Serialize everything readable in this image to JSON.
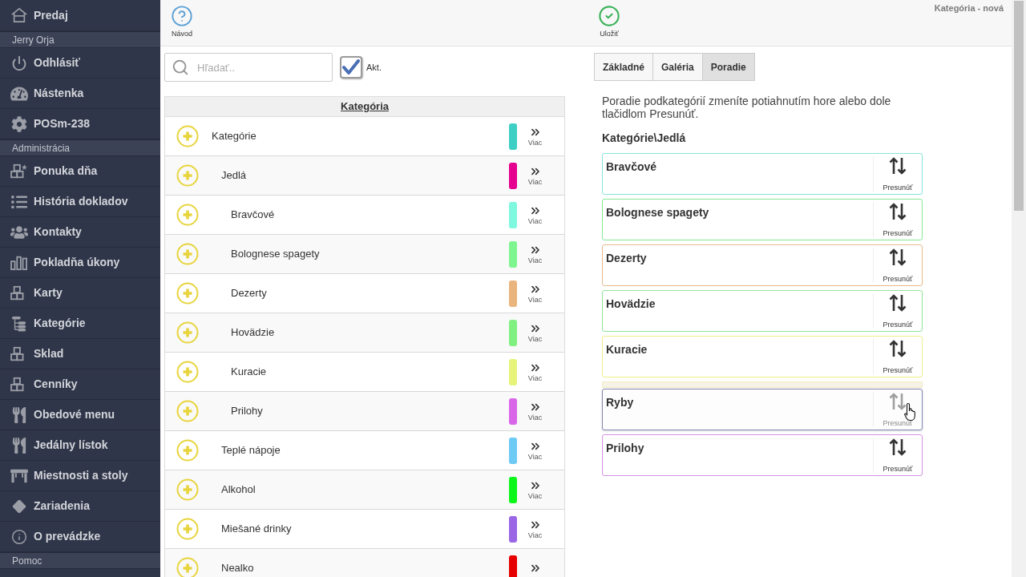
{
  "sidebar": {
    "items": [
      {
        "kind": "link",
        "label": "Predaj"
      },
      {
        "kind": "section",
        "label": "Jerry Orja"
      },
      {
        "kind": "link",
        "label": "Odhlásiť"
      },
      {
        "kind": "link",
        "label": "Nástenka"
      },
      {
        "kind": "link",
        "label": "POSm-238"
      },
      {
        "kind": "section",
        "label": "Administrácia"
      },
      {
        "kind": "link",
        "label": "Ponuka dňa"
      },
      {
        "kind": "link",
        "label": "História dokladov"
      },
      {
        "kind": "link",
        "label": "Kontakty"
      },
      {
        "kind": "link",
        "label": "Pokladňa úkony"
      },
      {
        "kind": "link",
        "label": "Karty"
      },
      {
        "kind": "link",
        "label": "Kategórie"
      },
      {
        "kind": "link",
        "label": "Sklad"
      },
      {
        "kind": "link",
        "label": "Cenníky"
      },
      {
        "kind": "link",
        "label": "Obedové menu"
      },
      {
        "kind": "link",
        "label": "Jedálny lístok"
      },
      {
        "kind": "link",
        "label": "Miestnosti a stoly"
      },
      {
        "kind": "link",
        "label": "Zariadenia"
      },
      {
        "kind": "link",
        "label": "O prevádzke"
      },
      {
        "kind": "section",
        "label": "Pomoc"
      }
    ]
  },
  "toolbar": {
    "buttons": [
      {
        "kind": "help",
        "label": "Návod"
      },
      {
        "kind": "save",
        "label": "Uložiť"
      }
    ],
    "title": "Kategória - nová"
  },
  "filter": {
    "search": {
      "placeholder": "Hľadať.."
    },
    "active": {
      "label": "Akt.",
      "checked": true
    }
  },
  "category_table": {
    "header": "Kategória",
    "rows": [
      {
        "name": "Kategórie",
        "color": "#3ecfc4",
        "more_label": "Viac",
        "children": [
          {
            "name": "Jedlá",
            "color": "#e6008f",
            "more_label": "Viac",
            "children": [
              {
                "name": "Bravčové",
                "color": "#7ff8e0",
                "more_label": "Viac"
              },
              {
                "name": "Bolognese spagety",
                "color": "#7ff58f",
                "more_label": "Viac"
              },
              {
                "name": "Dezerty",
                "color": "#eab57d",
                "more_label": "Viac"
              },
              {
                "name": "Hovädzie",
                "color": "#80f080",
                "more_label": "Viac"
              },
              {
                "name": "Kuracie",
                "color": "#e6f47a",
                "more_label": "Viac"
              },
              {
                "name": "Prilohy",
                "color": "#d966e8",
                "more_label": "Viac"
              }
            ]
          },
          {
            "name": "Teplé nápoje",
            "color": "#6ccaf5",
            "more_label": "Viac"
          },
          {
            "name": "Alkohol",
            "color": "#0bf71a",
            "more_label": "Viac"
          },
          {
            "name": "Miešané drinky",
            "color": "#9a66e6",
            "more_label": "Viac"
          },
          {
            "name": "Nealko",
            "color": "#e60000"
          }
        ]
      }
    ]
  },
  "tabs": [
    {
      "label": "Základné",
      "selected": false
    },
    {
      "label": "Galéria",
      "selected": false
    },
    {
      "label": "Poradie",
      "selected": true
    }
  ],
  "order_panel": {
    "instructions": "Poradie podkategórií zmeníte potiahnutím hore alebo dole tlačidlom Presunúť.",
    "path": "Kategórie\\Jedlá",
    "items": [
      {
        "name": "Bravčové",
        "color": "#86e5dc",
        "move_label": "Presunúť",
        "dragging": false
      },
      {
        "name": "Bolognese spagety",
        "color": "#85e895",
        "move_label": "Presunúť",
        "dragging": false
      },
      {
        "name": "Dezerty",
        "color": "#e5bb8a",
        "move_label": "Presunúť",
        "dragging": false
      },
      {
        "name": "Hovädzie",
        "color": "#8fe59a",
        "move_label": "Presunúť",
        "dragging": false
      },
      {
        "name": "Kuracie",
        "color": "#f0ee8a",
        "move_label": "Presunúť",
        "dragging": false
      },
      {
        "name": "Ryby",
        "color": "#8486b0",
        "move_label": "Presunúť",
        "dragging": true
      },
      {
        "name": "Prilohy",
        "color": "#d291e0",
        "move_label": "Presunúť",
        "dragging": false
      }
    ]
  }
}
